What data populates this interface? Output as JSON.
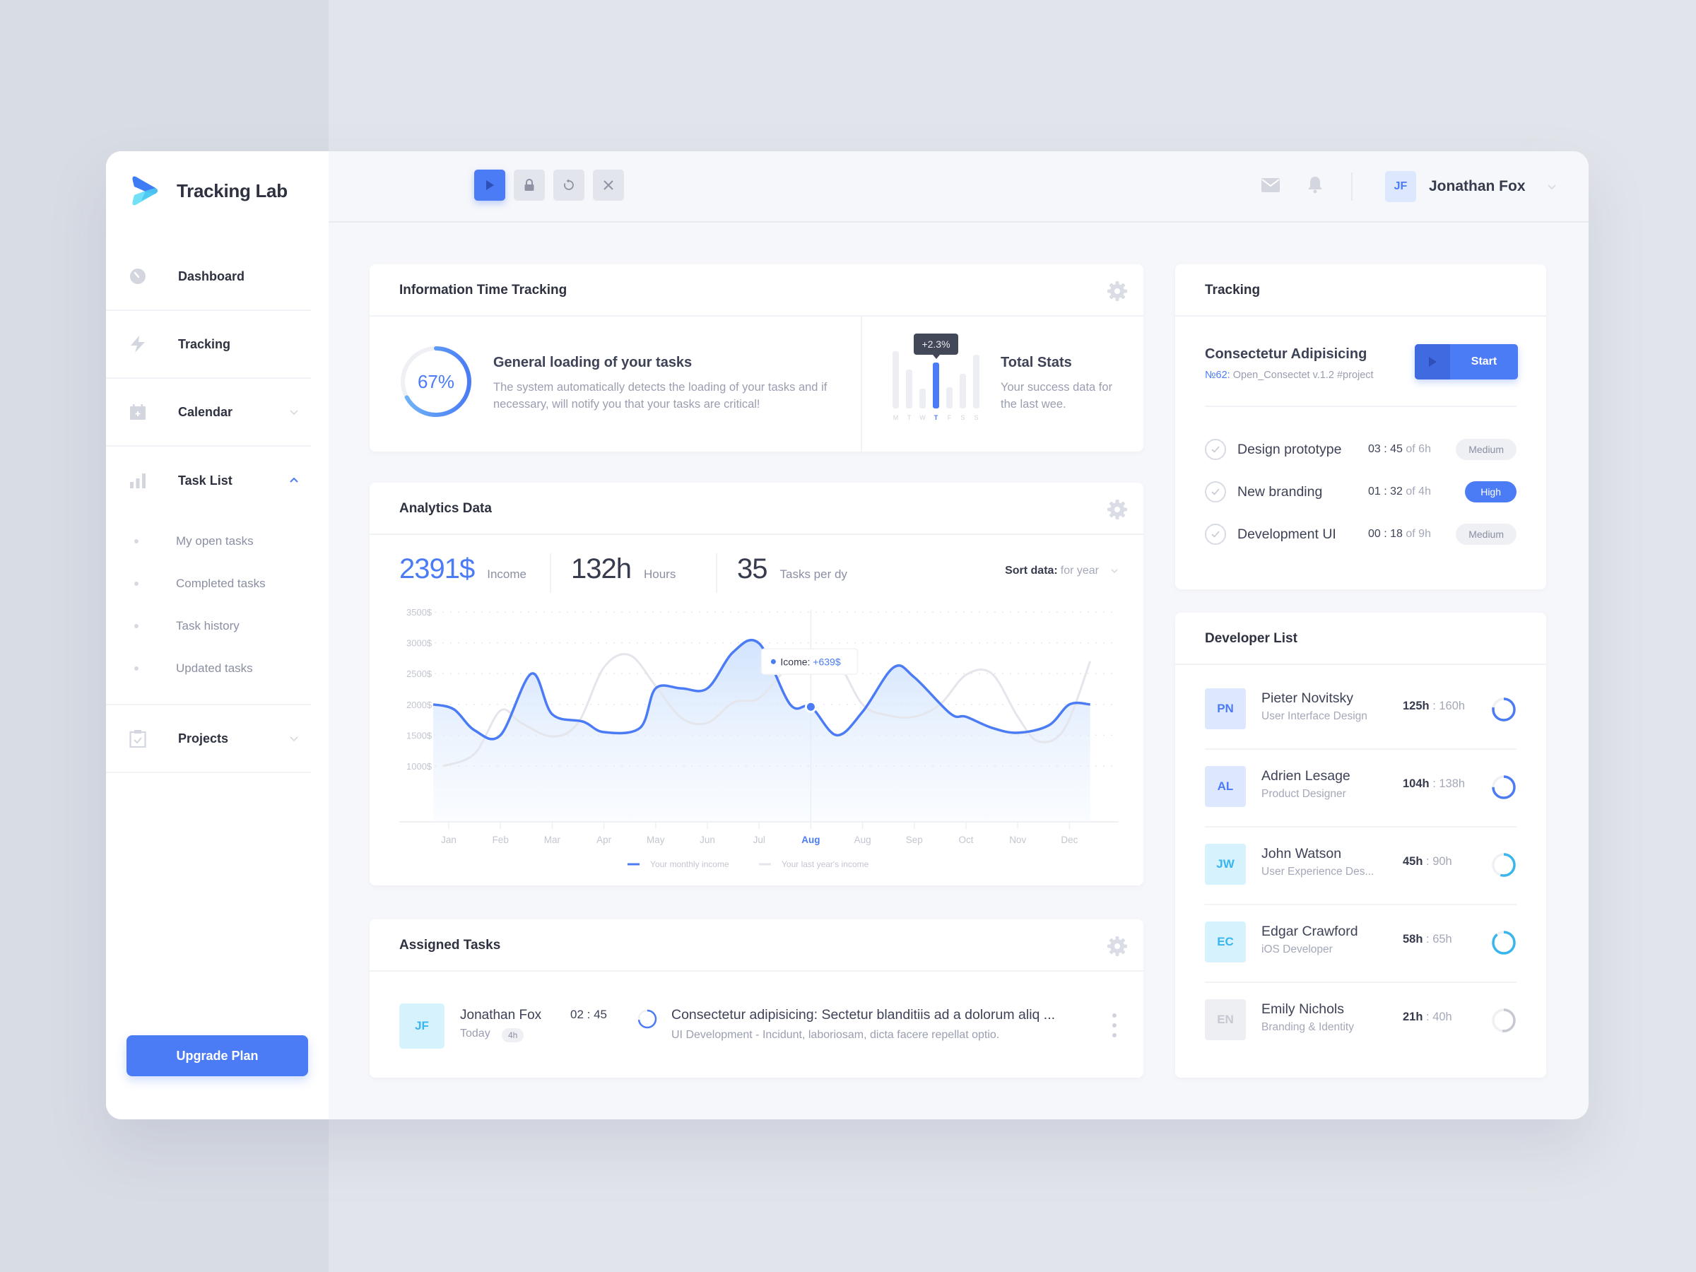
{
  "app": {
    "name": "Tracking Lab"
  },
  "colors": {
    "accent": "#4b7bf5",
    "accent_dark": "#3f6ae0",
    "cyan": "#39b6ee",
    "muted": "#9a9eb0"
  },
  "sidebar": {
    "items": [
      {
        "label": "Dashboard",
        "icon": "dashboard-gauge-icon"
      },
      {
        "label": "Tracking",
        "icon": "lightning-icon"
      },
      {
        "label": "Calendar",
        "icon": "calendar-icon",
        "expandable": true,
        "expanded": false
      },
      {
        "label": "Task List",
        "icon": "bar-chart-icon",
        "expandable": true,
        "expanded": true,
        "children": [
          {
            "label": "My open tasks"
          },
          {
            "label": "Completed tasks"
          },
          {
            "label": "Task history"
          },
          {
            "label": "Updated tasks"
          }
        ]
      },
      {
        "label": "Projects",
        "icon": "clipboard-check-icon",
        "expandable": true,
        "expanded": false
      }
    ],
    "upgrade_label": "Upgrade Plan"
  },
  "topbar": {
    "controls": [
      {
        "icon": "play-icon",
        "active": true
      },
      {
        "icon": "lock-icon",
        "active": false
      },
      {
        "icon": "refresh-icon",
        "active": false
      },
      {
        "icon": "close-icon",
        "active": false
      }
    ],
    "user": {
      "initials": "JF",
      "name": "Jonathan Fox"
    }
  },
  "info_card": {
    "title": "Information Time Tracking",
    "loading": {
      "percent": 67,
      "percent_label": "67%",
      "title": "General loading of your tasks",
      "description": "The system automatically detects the loading of your tasks and if necessary, will notify you that your tasks are critical!"
    },
    "total_stats": {
      "title": "Total Stats",
      "description": "Your success data for the last wee.",
      "tooltip": "+2.3%",
      "days": [
        "M",
        "T",
        "W",
        "T",
        "F",
        "S",
        "S"
      ],
      "values": [
        0.92,
        0.62,
        0.32,
        0.74,
        0.34,
        0.56,
        0.86
      ],
      "active_index": 3
    }
  },
  "analytics": {
    "title": "Analytics Data",
    "stats": [
      {
        "value": "2391$",
        "label": "Income"
      },
      {
        "value": "132h",
        "label": "Hours"
      },
      {
        "value": "35",
        "label": "Tasks per dy"
      }
    ],
    "sort": {
      "label": "Sort data:",
      "value": "for year"
    }
  },
  "chart_data": {
    "type": "area",
    "title": "Analytics Data",
    "xlabel": "",
    "ylabel": "",
    "categories": [
      "Jan",
      "Feb",
      "Mar",
      "Apr",
      "May",
      "Jun",
      "Jul",
      "Aug",
      "Aug",
      "Sep",
      "Oct",
      "Nov",
      "Dec"
    ],
    "highlight_index": 7,
    "y_ticks": [
      "3500$",
      "3000$",
      "2500$",
      "2000$",
      "1500$",
      "1000$"
    ],
    "ylim": [
      500,
      3600
    ],
    "grid": true,
    "series": [
      {
        "name": "Your monthly income",
        "color": "#4b7bf5",
        "x": [
          -0.3,
          0.1,
          0.5,
          1.0,
          1.6,
          2.0,
          2.6,
          3.0,
          3.7,
          4.0,
          4.5,
          5.0,
          5.5,
          6.0,
          6.6,
          7.0,
          7.5,
          8.0,
          8.6,
          9.0,
          9.7,
          10.0,
          10.5,
          11.0,
          11.6,
          12.0,
          12.4
        ],
        "values": [
          2000,
          1920,
          1580,
          1500,
          2500,
          1840,
          1720,
          1550,
          1620,
          2260,
          2260,
          2260,
          2850,
          2990,
          2000,
          1960,
          1500,
          1880,
          2600,
          2440,
          1850,
          1800,
          1620,
          1540,
          1660,
          2000,
          2000
        ]
      },
      {
        "name": "Your last year's income",
        "color": "#e6e8ee",
        "x": [
          -0.1,
          0.5,
          1.0,
          1.4,
          2.0,
          2.5,
          3.0,
          3.5,
          4.0,
          4.5,
          5.0,
          5.5,
          6.0,
          6.5,
          7.0,
          7.5,
          8.0,
          8.5,
          9.0,
          9.5,
          10.0,
          10.5,
          11.0,
          11.4,
          11.9,
          12.4
        ],
        "values": [
          1000,
          1200,
          1900,
          1700,
          1480,
          1700,
          2600,
          2800,
          2300,
          1780,
          1700,
          2030,
          2100,
          2550,
          2800,
          2700,
          2000,
          1820,
          1800,
          2000,
          2480,
          2500,
          1800,
          1400,
          1600,
          2700
        ]
      }
    ],
    "tooltip": {
      "index": 7,
      "label": "Icome:",
      "value": "+639$"
    },
    "legend": [
      "Your monthly income",
      "Your last year's income"
    ],
    "legend_position": "bottom-center"
  },
  "assigned_tasks": {
    "title": "Assigned Tasks",
    "rows": [
      {
        "initials": "JF",
        "name": "Jonathan Fox",
        "day": "Today",
        "duration": "4h",
        "time": "02 : 45",
        "title": "Consectetur adipisicing: Sectetur blanditiis ad a dolorum aliq ...",
        "subtitle": "UI Development - Incidunt, laboriosam, dicta facere repellat optio."
      }
    ]
  },
  "tracking": {
    "title": "Tracking",
    "current": {
      "title": "Consectetur Adipisicing",
      "number": "№62:",
      "project": "Open_Consectet v.1.2 #project",
      "start_label": "Start"
    },
    "tasks": [
      {
        "name": "Design prototype",
        "elapsed": "03 : 45",
        "of": "of 6h",
        "priority": "Medium"
      },
      {
        "name": "New branding",
        "elapsed": "01 : 32",
        "of": "of 4h",
        "priority": "High"
      },
      {
        "name": "Development UI",
        "elapsed": "00 : 18",
        "of": "of 9h",
        "priority": "Medium"
      }
    ]
  },
  "developers": {
    "title": "Developer List",
    "items": [
      {
        "initials": "PN",
        "name": "Pieter Novitsky",
        "role": "User Interface Design",
        "hours": "125h",
        "total": ": 160h",
        "progress": 0.78,
        "color": "#4b7bf5",
        "bg": "#dde7fd"
      },
      {
        "initials": "AL",
        "name": "Adrien Lesage",
        "role": "Product Designer",
        "hours": "104h",
        "total": ": 138h",
        "progress": 0.75,
        "color": "#4b7bf5",
        "bg": "#dde7fd"
      },
      {
        "initials": "JW",
        "name": "John Watson",
        "role": "User Experience Des...",
        "hours": "45h",
        "total": ": 90h",
        "progress": 0.55,
        "color": "#39b6ee",
        "bg": "#d5f2fd"
      },
      {
        "initials": "EC",
        "name": "Edgar Crawford",
        "role": "iOS Developer",
        "hours": "58h",
        "total": ": 65h",
        "progress": 0.89,
        "color": "#39b6ee",
        "bg": "#d5f2fd"
      },
      {
        "initials": "EN",
        "name": "Emily Nichols",
        "role": "Branding & Identity",
        "hours": "21h",
        "total": ": 40h",
        "progress": 0.52,
        "color": "#c6c9d2",
        "bg": "#eeeff3"
      }
    ]
  }
}
